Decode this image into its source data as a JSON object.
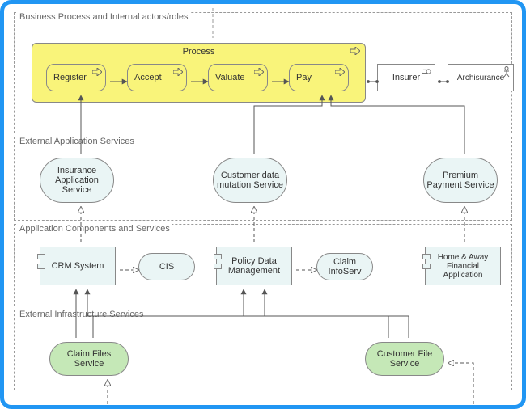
{
  "layers": {
    "l1": "Business Process and Internal actors/roles",
    "l2": "External Application Services",
    "l3": "Application Components and Services",
    "l4": "External Infrastructure Services"
  },
  "process": {
    "container": "Process",
    "steps": {
      "s1": "Register",
      "s2": "Accept",
      "s3": "Valuate",
      "s4": "Pay"
    }
  },
  "actors": {
    "role": "Insurer",
    "actor": "Archisurance"
  },
  "services_ext_app": {
    "a1": "Insurance Application Service",
    "a2": "Customer data mutation Service",
    "a3": "Premium Payment Service"
  },
  "app_components": {
    "c1": "CRM System",
    "c1s": "CIS",
    "c2": "Policy Data Management",
    "c2s": "Claim InfoServ",
    "c3": "Home & Away Financial Application"
  },
  "infra": {
    "i1": "Claim Files Service",
    "i2": "Customer File Service"
  },
  "icons": {
    "arrow": "arrow-icon",
    "role": "role-icon",
    "actor": "actor-icon",
    "component": "component-icon"
  }
}
